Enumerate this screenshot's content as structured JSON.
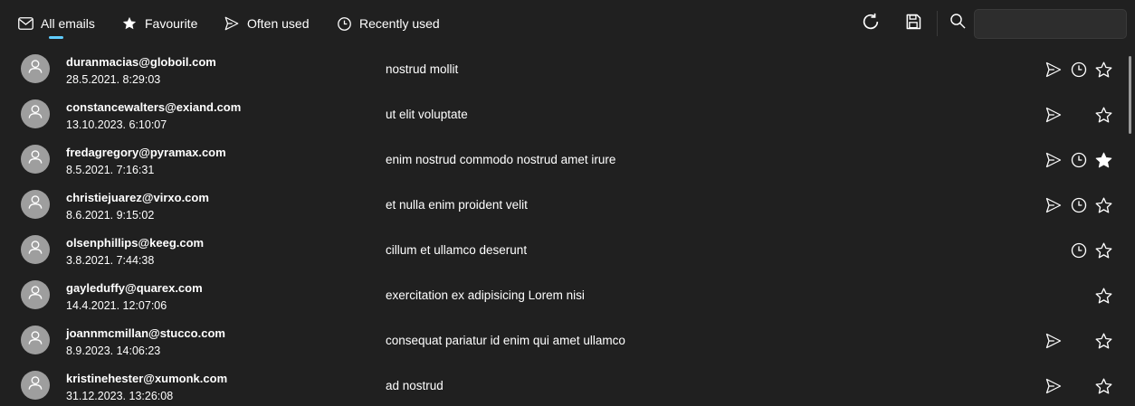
{
  "tabs": [
    {
      "label": "All emails",
      "icon": "mail-icon"
    },
    {
      "label": "Favourite",
      "icon": "star-filled-icon"
    },
    {
      "label": "Often used",
      "icon": "send-icon"
    },
    {
      "label": "Recently used",
      "icon": "clock-icon"
    }
  ],
  "toolbar": {
    "refresh_icon": "refresh-icon",
    "save_icon": "save-icon",
    "search_icon": "search-icon",
    "search_value": ""
  },
  "emails": [
    {
      "email": "duranmacias@globoil.com",
      "date": "28.5.2021. 8:29:03",
      "subject": "nostrud mollit",
      "often_used": true,
      "recently_used": true,
      "favourite": false
    },
    {
      "email": "constancewalters@exiand.com",
      "date": "13.10.2023. 6:10:07",
      "subject": "ut elit voluptate",
      "often_used": true,
      "recently_used": false,
      "favourite": false
    },
    {
      "email": "fredagregory@pyramax.com",
      "date": "8.5.2021. 7:16:31",
      "subject": "enim nostrud commodo nostrud amet irure",
      "often_used": true,
      "recently_used": true,
      "favourite": true
    },
    {
      "email": "christiejuarez@virxo.com",
      "date": "8.6.2021. 9:15:02",
      "subject": "et nulla enim proident velit",
      "often_used": true,
      "recently_used": true,
      "favourite": false
    },
    {
      "email": "olsenphillips@keeg.com",
      "date": "3.8.2021. 7:44:38",
      "subject": "cillum et ullamco deserunt",
      "often_used": false,
      "recently_used": true,
      "favourite": false
    },
    {
      "email": "gayleduffy@quarex.com",
      "date": "14.4.2021. 12:07:06",
      "subject": "exercitation ex adipisicing Lorem nisi",
      "often_used": false,
      "recently_used": false,
      "favourite": false
    },
    {
      "email": "joannmcmillan@stucco.com",
      "date": "8.9.2023. 14:06:23",
      "subject": "consequat pariatur id enim qui amet ullamco",
      "often_used": true,
      "recently_used": false,
      "favourite": false
    },
    {
      "email": "kristinehester@xumonk.com",
      "date": "31.12.2023. 13:26:08",
      "subject": "ad nostrud",
      "often_used": true,
      "recently_used": false,
      "favourite": false
    }
  ],
  "colors": {
    "background": "#202020",
    "accent": "#60cdff",
    "avatar": "#9e9e9e",
    "text": "#ffffff"
  }
}
